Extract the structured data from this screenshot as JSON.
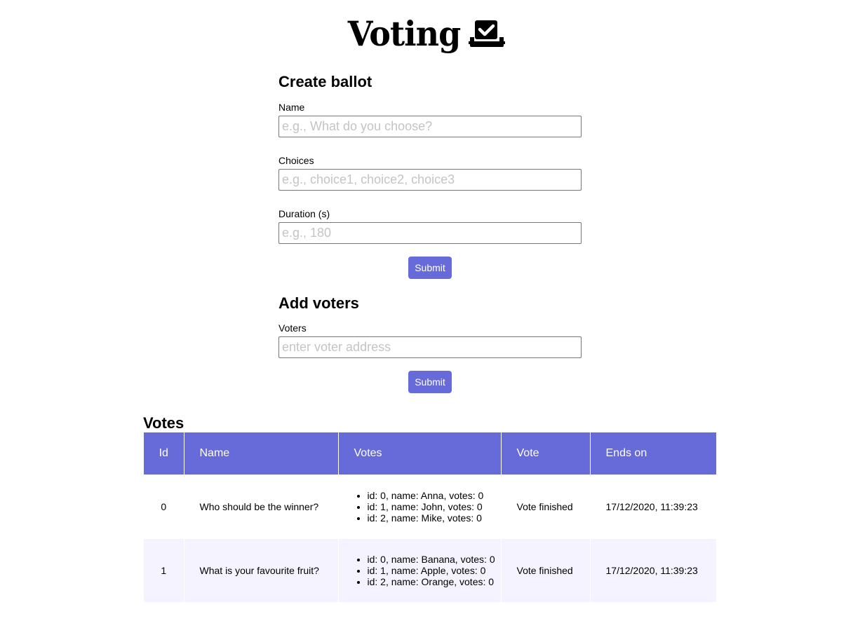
{
  "header": {
    "title": "Voting",
    "icon": "ballot-box-icon"
  },
  "create_ballot": {
    "title": "Create ballot",
    "name_label": "Name",
    "name_placeholder": "e.g., What do you choose?",
    "choices_label": "Choices",
    "choices_placeholder": "e.g., choice1, choice2, choice3",
    "duration_label": "Duration (s)",
    "duration_placeholder": "e.g., 180",
    "submit_label": "Submit"
  },
  "add_voters": {
    "title": "Add voters",
    "voters_label": "Voters",
    "voters_placeholder": "enter voter address",
    "submit_label": "Submit"
  },
  "votes": {
    "title": "Votes",
    "columns": [
      "Id",
      "Name",
      "Votes",
      "Vote",
      "Ends on"
    ],
    "rows": [
      {
        "id": "0",
        "name": "Who should be the winner?",
        "choices": [
          "id: 0, name: Anna, votes: 0",
          "id: 1, name: John, votes: 0",
          "id: 2, name: Mike, votes: 0"
        ],
        "vote": "Vote finished",
        "ends_on": "17/12/2020, 11:39:23"
      },
      {
        "id": "1",
        "name": "What is your favourite fruit?",
        "choices": [
          "id: 0, name: Banana, votes: 0",
          "id: 1, name: Apple, votes: 0",
          "id: 2, name: Orange, votes: 0"
        ],
        "vote": "Vote finished",
        "ends_on": "17/12/2020, 11:39:23"
      }
    ]
  },
  "colors": {
    "accent": "#666bd9",
    "row_alt": "#f5f3ff",
    "placeholder": "#c4c4c4"
  }
}
